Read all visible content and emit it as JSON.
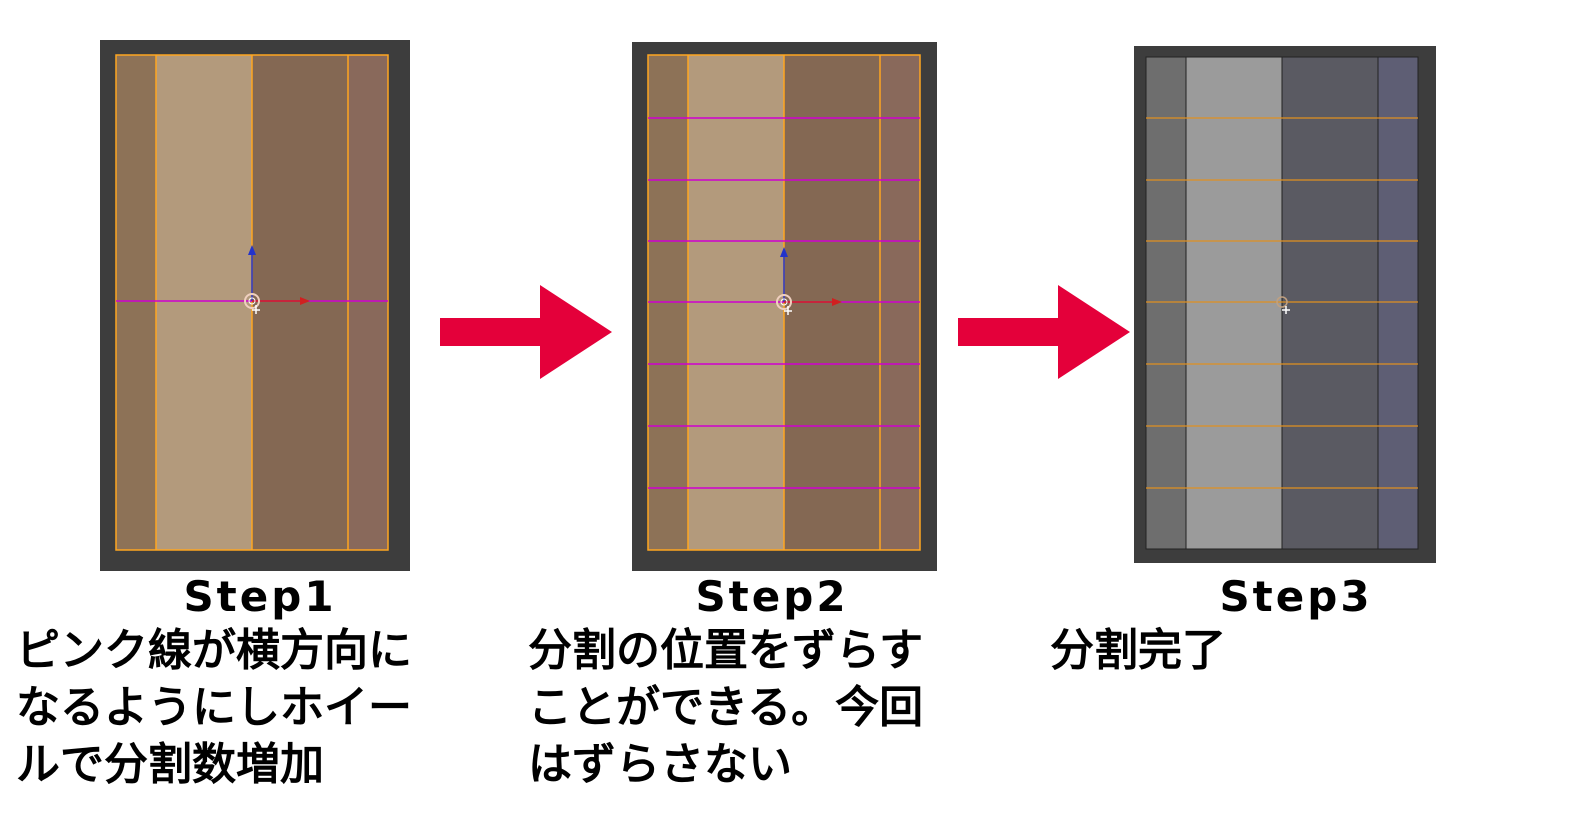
{
  "steps": [
    {
      "title": "Step1",
      "description": [
        "ピンク線が横方向に",
        "なるようにしホイー",
        "ルで分割数増加"
      ]
    },
    {
      "title": "Step2",
      "description": [
        "分割の位置をずらす",
        "ことができる。今回",
        "はずらさない"
      ]
    },
    {
      "title": "Step3",
      "description": [
        "分割完了"
      ]
    }
  ],
  "colors": {
    "arrow": "#e4003a",
    "viewport_bg": "#3d3d3d",
    "edge_selected": "#ffa620",
    "edge_preview": "#d000d0",
    "face_light": "#b39a7c",
    "face_dark": "#846853",
    "face_light_gray": "#9b9b9b",
    "face_dark_gray": "#5a5a62"
  },
  "icons": [
    "right-arrow-icon",
    "transform-gizmo-icon",
    "3d-cursor-icon"
  ]
}
